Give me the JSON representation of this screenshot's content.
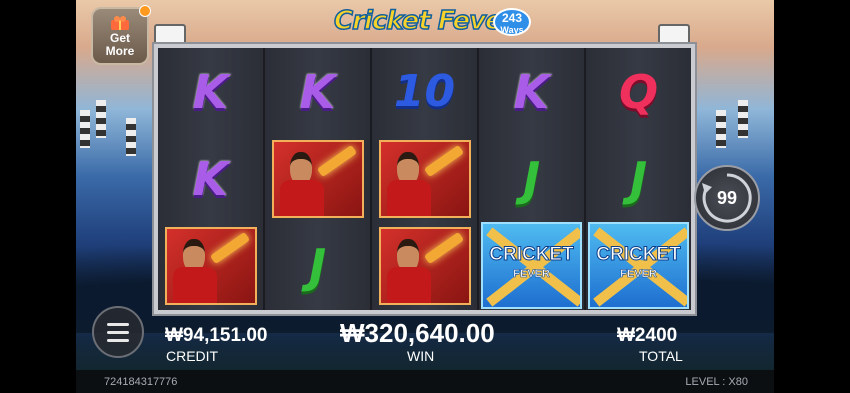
{
  "game": {
    "logo_title": "Cricket Fever",
    "ways_number": "243",
    "ways_label": "Ways",
    "get_more_label_1": "Get",
    "get_more_label_2": "More"
  },
  "reels": [
    [
      "K",
      "K",
      "player"
    ],
    [
      "K",
      "player",
      "J"
    ],
    [
      "10",
      "player",
      "player"
    ],
    [
      "K",
      "J",
      "wild"
    ],
    [
      "Q",
      "J",
      "wild"
    ]
  ],
  "wild_symbol": {
    "line1": "CRICKET",
    "line2": "FEVER"
  },
  "spin_button": {
    "auto_count": "99"
  },
  "stats": {
    "credit_value": "₩94,151.00",
    "credit_label": "CREDIT",
    "win_value": "₩320,640.00",
    "win_label": "WIN",
    "total_value": "₩2400",
    "total_label": "TOTAL"
  },
  "footer": {
    "session_id": "724184317776",
    "level": "LEVEL : X80"
  },
  "colors": {
    "K": "#a95ce8",
    "Q": "#ef2f5c",
    "ten": "#2c5ae0",
    "J": "#34c03a",
    "logo_yellow": "#f6d22a"
  }
}
